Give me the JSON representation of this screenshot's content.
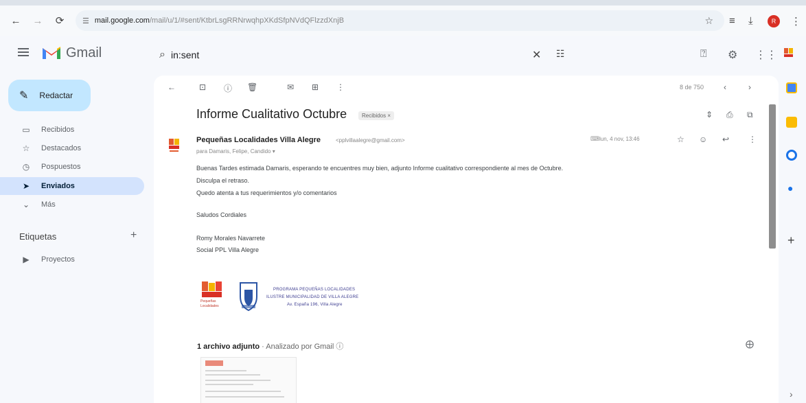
{
  "browser": {
    "url_host": "mail.google.com",
    "url_path": "/mail/u/1/#sent/KtbrLsgRRNrwqhpXKdSfpNVdQFlzzdXnjB",
    "profile_initial": "R"
  },
  "app": {
    "name": "Gmail"
  },
  "search": {
    "query": "in:sent"
  },
  "nav": {
    "compose_label": "Redactar",
    "items": [
      {
        "label": "Recibidos"
      },
      {
        "label": "Destacados"
      },
      {
        "label": "Pospuestos"
      },
      {
        "label": "Enviados"
      },
      {
        "label": "Más"
      }
    ],
    "labels_heading": "Etiquetas",
    "labels": [
      {
        "label": "Proyectos"
      }
    ]
  },
  "toolbar": {
    "pagination": "8 de 750"
  },
  "email": {
    "subject": "Informe Cualitativo Octubre",
    "label_chip": "Recibidos ×",
    "sender_name": "Pequeñas Localidades Villa Alegre",
    "sender_email": "<pplvillaalegre@gmail.com>",
    "recipients": "para Damaris, Felipe, Candido ▾",
    "date": "lun, 4 nov, 13:46",
    "body": [
      "Buenas Tardes estimada Damaris, esperando te encuentres muy bien, adjunto Informe cualitativo correspondiente al mes de Octubre.",
      "Disculpa el retraso.",
      "Quedo atenta a tus requerimientos y/o comentarios",
      "Saludos Cordiales",
      "Romy Morales Navarrete",
      "Social PPL Villa Alegre"
    ],
    "signature": {
      "logo_word": "Pequeñas Localidades",
      "org_lines": [
        "PROGRAMA PEQUEÑAS LOCALIDADES",
        "ILUSTRE MUNICIPALIDAD DE VILLA ALEGRE",
        "Av. España 196, Villa Alegre"
      ]
    },
    "attachments_label": "1 archivo adjunto",
    "attachments_sub": "· Analizado por Gmail ⓘ"
  },
  "colors": {
    "compose_bg": "#c2e7ff",
    "active_nav_bg": "#d3e3fd",
    "gmail_red": "#ea4335"
  }
}
